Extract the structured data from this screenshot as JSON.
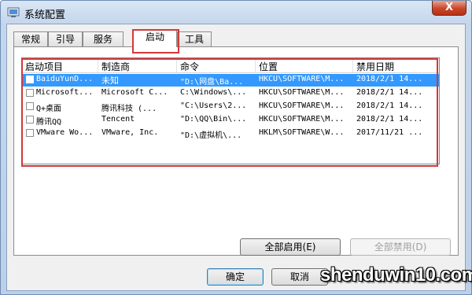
{
  "window": {
    "title": "系统配置",
    "close_label": "X"
  },
  "tabs": [
    {
      "label": "常规"
    },
    {
      "label": "引导"
    },
    {
      "label": "服务"
    },
    {
      "label": "启动",
      "active": true
    },
    {
      "label": "工具"
    }
  ],
  "startup_list": {
    "columns": [
      "启动项目",
      "制造商",
      "命令",
      "位置",
      "禁用日期"
    ],
    "rows": [
      {
        "item": "BaiduYunD...",
        "maker": "未知",
        "command": "\"D:\\网盘\\Ba...",
        "location": "HKCU\\SOFTWARE\\M...",
        "date": "2018/2/1 14...",
        "selected": true
      },
      {
        "item": "Microsoft...",
        "maker": "Microsoft C...",
        "command": "C:\\Windows\\...",
        "location": "HKCU\\SOFTWARE\\M...",
        "date": "2018/2/1 14..."
      },
      {
        "item": "Q+桌面",
        "maker": "腾讯科技 (...",
        "command": "\"C:\\Users\\2...",
        "location": "HKCU\\SOFTWARE\\M...",
        "date": "2018/2/1 14..."
      },
      {
        "item": "腾讯QQ",
        "maker": "Tencent",
        "command": "\"D:\\QQ\\Bin\\...",
        "location": "HKCU\\SOFTWARE\\M...",
        "date": "2018/2/1 14..."
      },
      {
        "item": "VMware Wo...",
        "maker": "VMware, Inc.",
        "command": "\"D:\\虚拟机\\...",
        "location": "HKLM\\SOFTWARE\\W...",
        "date": "2017/11/21 ..."
      }
    ]
  },
  "buttons": {
    "enable_all": "全部启用(E)",
    "disable_all": "全部禁用(D)",
    "ok": "确定",
    "cancel": "取消"
  },
  "watermark": "shenduwin10.com",
  "colors": {
    "highlight_red": "#d43838",
    "selection_blue": "#3399ff"
  }
}
